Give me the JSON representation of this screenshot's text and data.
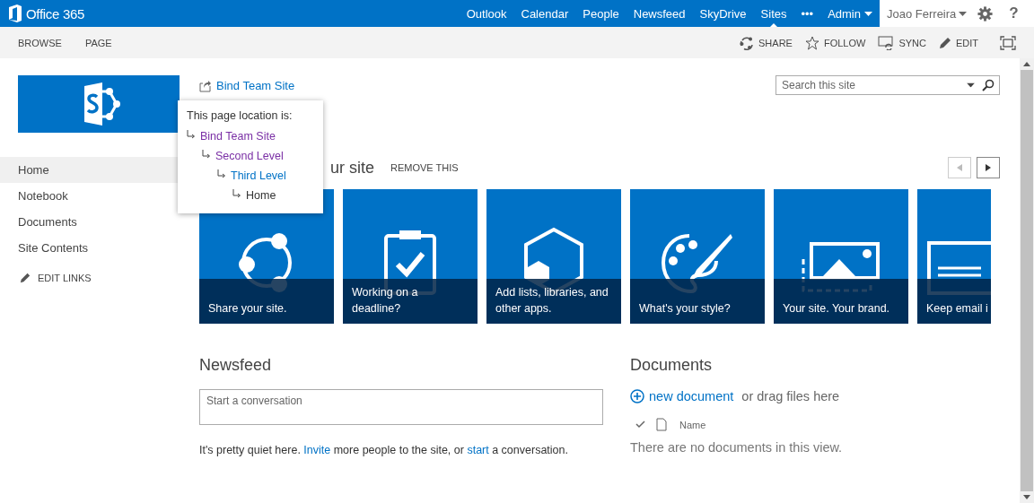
{
  "suite_bar": {
    "brand": "Office 365",
    "nav": [
      {
        "label": "Outlook",
        "selected": false
      },
      {
        "label": "Calendar",
        "selected": false
      },
      {
        "label": "People",
        "selected": false
      },
      {
        "label": "Newsfeed",
        "selected": false
      },
      {
        "label": "SkyDrive",
        "selected": false
      },
      {
        "label": "Sites",
        "selected": true
      },
      {
        "label": "•••",
        "selected": false
      },
      {
        "label": "Admin",
        "selected": false
      }
    ],
    "user": "Joao Ferreira",
    "help": "?"
  },
  "ribbon": {
    "tabs": [
      "BROWSE",
      "PAGE"
    ],
    "actions": [
      "SHARE",
      "FOLLOW",
      "SYNC",
      "EDIT"
    ]
  },
  "search": {
    "placeholder": "Search this site"
  },
  "breadcrumb": "Bind Team Site",
  "location_popup": {
    "title": "This page location is:",
    "tree": [
      {
        "label": "Bind Team Site",
        "kind": "link",
        "visited": true,
        "children": [
          {
            "label": "Second Level",
            "kind": "link",
            "visited": true,
            "children": [
              {
                "label": "Third Level",
                "kind": "link",
                "visited": false,
                "children": [
                  {
                    "label": "Home",
                    "kind": "current"
                  }
                ]
              }
            ]
          }
        ]
      }
    ]
  },
  "left_nav": {
    "items": [
      {
        "label": "Home",
        "selected": true
      },
      {
        "label": "Notebook",
        "selected": false
      },
      {
        "label": "Documents",
        "selected": false
      },
      {
        "label": "Site Contents",
        "selected": false
      }
    ],
    "edit_links": "EDIT LINKS"
  },
  "getting_started": {
    "heading": "ur site",
    "remove": "REMOVE THIS",
    "tiles": [
      "Share your site.",
      "Working on a deadline?",
      "Add lists, libraries, and other apps.",
      "What's your style?",
      "Your site. Your brand.",
      "Keep email i"
    ]
  },
  "newsfeed": {
    "title": "Newsfeed",
    "placeholder": "Start a conversation",
    "message": [
      {
        "kind": "text",
        "text": "It's pretty quiet here. "
      },
      {
        "kind": "link",
        "text": "Invite"
      },
      {
        "kind": "text",
        "text": " more people to the site, or "
      },
      {
        "kind": "link",
        "text": "start"
      },
      {
        "kind": "text",
        "text": " a conversation."
      }
    ]
  },
  "documents": {
    "title": "Documents",
    "new_document": "new document",
    "drag_hint": " or drag files here",
    "columns": [
      "Name"
    ],
    "empty": "There are no documents in this view."
  }
}
